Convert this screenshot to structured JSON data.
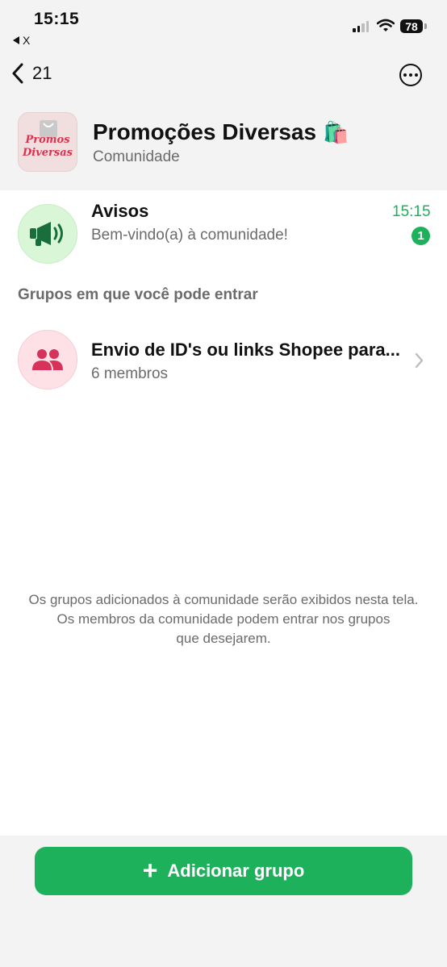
{
  "status_bar": {
    "time": "15:15",
    "back_app": "X",
    "battery": "78"
  },
  "nav": {
    "back_count": "21"
  },
  "community": {
    "name": "Promoções Diversas",
    "emoji": "🛍️",
    "subtitle": "Comunidade",
    "avatar_text_line1": "Promos",
    "avatar_text_line2": "Diversas"
  },
  "announcements": {
    "title": "Avisos",
    "preview": "Bem-vindo(a) à comunidade!",
    "time": "15:15",
    "unread_count": "1"
  },
  "groups_section": {
    "label": "Grupos em que você pode entrar",
    "items": [
      {
        "title": "Envio de ID's ou links Shopee para...",
        "subtitle": "6 membros"
      }
    ]
  },
  "info_text": {
    "line1": "Os grupos adicionados à comunidade serão exibidos nesta tela.",
    "line2": "Os membros da comunidade podem entrar nos grupos",
    "line3": "que desejarem."
  },
  "add_group_button": {
    "icon": "+",
    "label": "Adicionar grupo"
  },
  "colors": {
    "accent_green": "#1db15c",
    "background": "#f3f3f3",
    "muted_text": "#6b6b6b"
  }
}
